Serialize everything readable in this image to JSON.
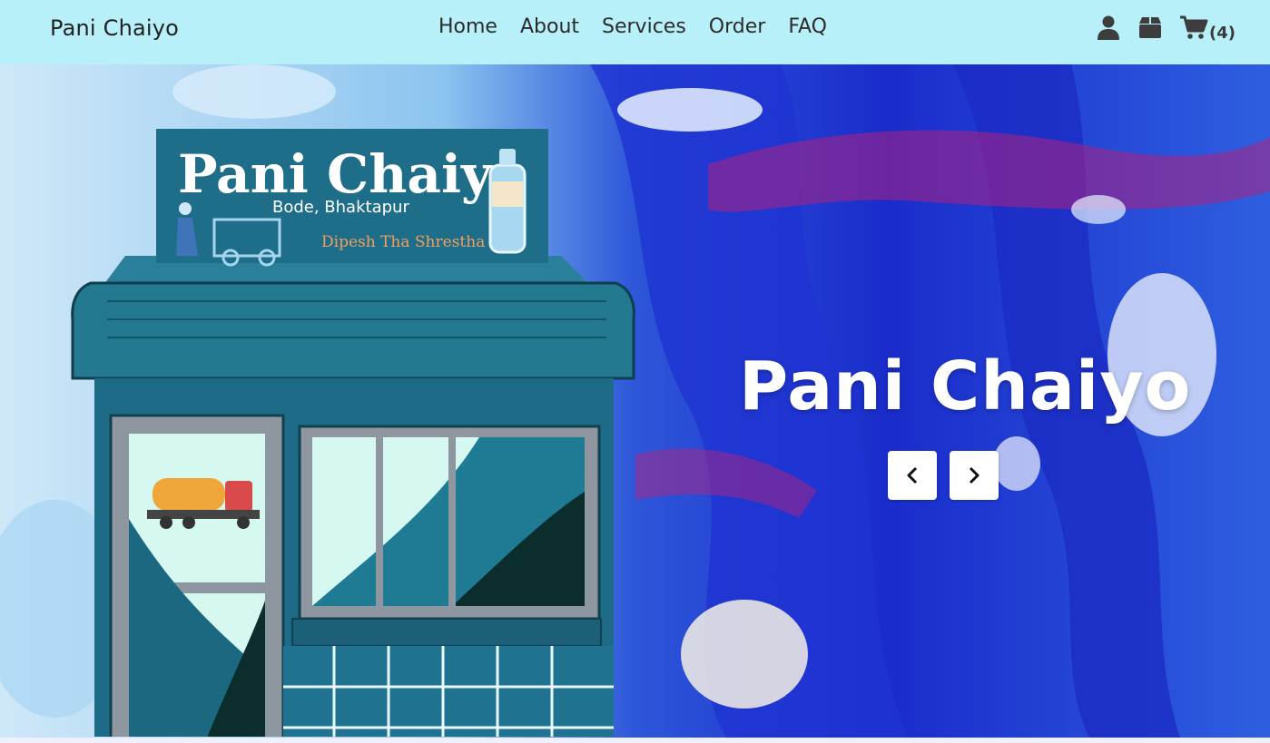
{
  "navbar": {
    "brand": "Pani Chaiyo",
    "links": [
      "Home",
      "About",
      "Services",
      "Order",
      "FAQ"
    ],
    "cart_count": "(4)",
    "icons": [
      "user-icon",
      "box-icon",
      "cart-icon"
    ]
  },
  "hero": {
    "title": "Pani Chaiyo",
    "sign": {
      "name": "Pani Chaiyo",
      "location": "Bode, Bhaktapur",
      "owner": "Dipesh Tha Shrestha"
    },
    "controls": [
      "chevron-left-icon",
      "chevron-right-icon"
    ]
  },
  "colors": {
    "navbar_bg": "#b8f0f9",
    "shop_teal": "#2a7f9b",
    "sign_teal": "#1e6d89",
    "sign_owner_orange": "#f0a060"
  }
}
